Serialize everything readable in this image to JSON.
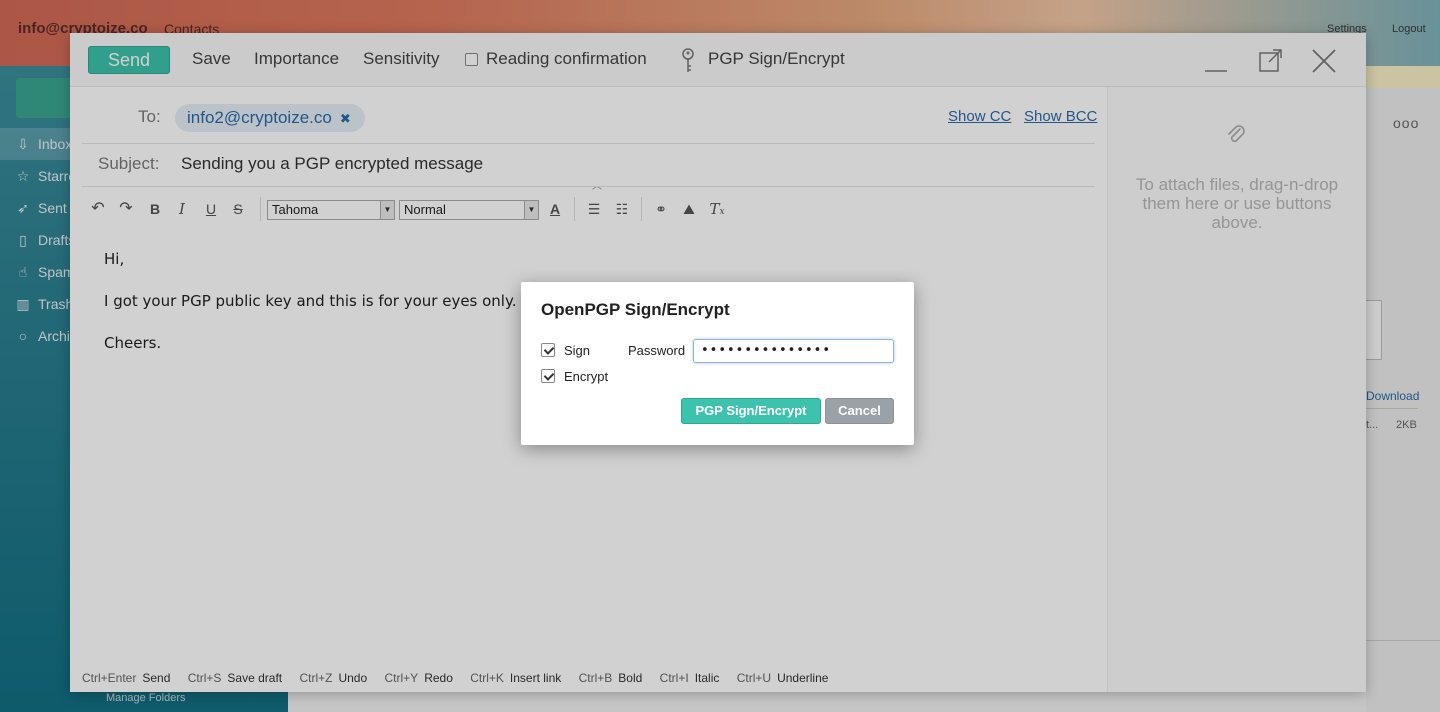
{
  "background": {
    "account": "info@cryptoize.co",
    "contacts": "Contacts",
    "settings": "Settings",
    "logout": "Logout",
    "folders": [
      {
        "label": "Inbox",
        "icon": "inbox-icon"
      },
      {
        "label": "Starred",
        "icon": "star-icon"
      },
      {
        "label": "Sent",
        "icon": "sent-icon"
      },
      {
        "label": "Drafts",
        "icon": "draft-icon"
      },
      {
        "label": "Spam",
        "icon": "spam-icon"
      },
      {
        "label": "Trash",
        "icon": "trash-icon"
      },
      {
        "label": "Archive",
        "icon": "archive-icon"
      }
    ],
    "manage_folders": "Manage Folders",
    "more": "ooo",
    "download": "Download",
    "file_name_truncated": "t...",
    "file_size": "2KB"
  },
  "toolbar": {
    "send": "Send",
    "save": "Save",
    "importance": "Importance",
    "sensitivity": "Sensitivity",
    "reading_confirmation": "Reading confirmation",
    "pgp": "PGP Sign/Encrypt"
  },
  "compose": {
    "to_label": "To:",
    "recipient": "info2@cryptoize.co",
    "show_cc": "Show CC",
    "show_bcc": "Show BCC",
    "subject_label": "Subject:",
    "subject": "Sending you a PGP encrypted message",
    "font": "Tahoma",
    "size": "Normal",
    "body": [
      "Hi,",
      "I got your PGP public key and this is for your eyes only.",
      "Cheers."
    ],
    "attach_hint": "To attach files, drag-n-drop them here or use buttons above."
  },
  "shortcuts": [
    {
      "key": "Ctrl+Enter",
      "action": "Send"
    },
    {
      "key": "Ctrl+S",
      "action": "Save draft"
    },
    {
      "key": "Ctrl+Z",
      "action": "Undo"
    },
    {
      "key": "Ctrl+Y",
      "action": "Redo"
    },
    {
      "key": "Ctrl+K",
      "action": "Insert link"
    },
    {
      "key": "Ctrl+B",
      "action": "Bold"
    },
    {
      "key": "Ctrl+I",
      "action": "Italic"
    },
    {
      "key": "Ctrl+U",
      "action": "Underline"
    }
  ],
  "dialog": {
    "title": "OpenPGP Sign/Encrypt",
    "sign": "Sign",
    "encrypt": "Encrypt",
    "password_label": "Password",
    "password_value": "•••••••••••••••",
    "primary": "PGP Sign/Encrypt",
    "cancel": "Cancel"
  },
  "colors": {
    "accent": "#3dc2ad",
    "link": "#2b6aa8",
    "cancel": "#9aa1a7"
  }
}
